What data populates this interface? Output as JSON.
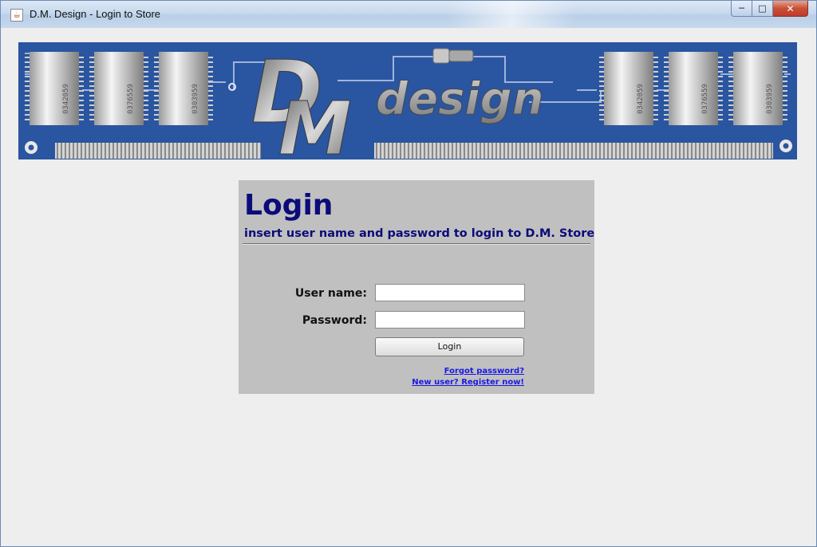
{
  "window": {
    "title": "D.M. Design - Login to Store",
    "app_icon": "java-cup-icon",
    "controls": {
      "minimize": "minimize-icon",
      "maximize": "maximize-icon",
      "close": "close-icon"
    }
  },
  "banner": {
    "logo_letters": "DM",
    "logo_word": "design",
    "chip_labels": [
      "0342059",
      "0376559",
      "0303959",
      "0342059",
      "0376559",
      "0303959"
    ],
    "background_color": "#2a55a0"
  },
  "login": {
    "title": "Login",
    "subtitle": "insert user name and password to login to D.M. Store",
    "username_label": "User name:",
    "username_value": "",
    "password_label": "Password:",
    "password_value": "",
    "login_button": "Login",
    "forgot_link": "Forgot password?",
    "register_link": "New user? Register now!",
    "title_color": "#0b0b7a",
    "link_color": "#1a1ae0"
  }
}
